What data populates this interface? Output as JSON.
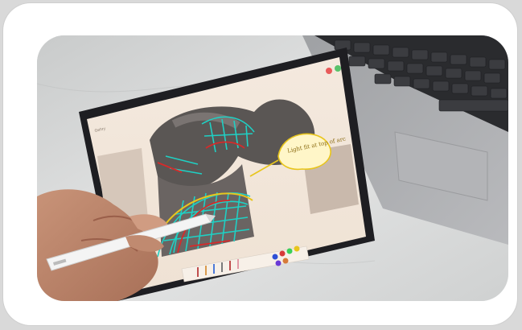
{
  "image": {
    "subject": "hand-drawing-on-tablet",
    "objects": [
      "tablet",
      "stylus",
      "hand",
      "laptop-keyboard",
      "marble-table"
    ],
    "colors": {
      "frame_bg": "#ffffff",
      "marble": "#d8dada",
      "tablet_bezel": "#1e1e22",
      "sketch_cyan": "#1fd0c4",
      "sketch_red": "#d62a2a",
      "sketch_yellow": "#e8c51c",
      "building_grey": "#5a5654",
      "laptop_silver": "#a9aaad"
    },
    "annotation_text": "Light fit at top of arc",
    "tablet_corner_label": "Gehry"
  }
}
